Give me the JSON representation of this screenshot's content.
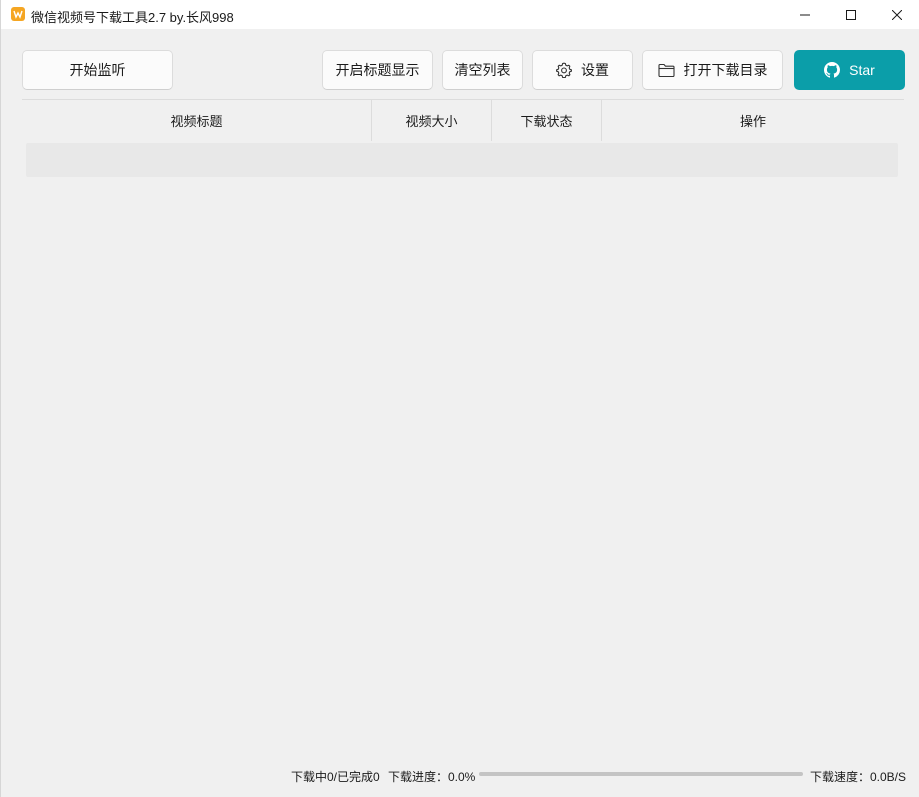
{
  "window": {
    "title": "微信视频号下载工具2.7 by.长风998",
    "icon": "app-logo-icon"
  },
  "toolbar": {
    "start_label": "开始监听",
    "title_display_label": "开启标题显示",
    "clear_label": "清空列表",
    "settings_label": "设置",
    "open_dir_label": "打开下载目录",
    "star_label": "Star"
  },
  "table": {
    "columns": [
      "视频标题",
      "视频大小",
      "下载状态",
      "操作"
    ],
    "rows": []
  },
  "status": {
    "downloading_text": "下载中0/已完成0",
    "progress_text": "下载进度：0.0%",
    "progress_value": 0.0,
    "speed_text": "下载速度：0.0B/S"
  },
  "colors": {
    "accent": "#0b9ea9",
    "icon": "#f5a623",
    "background": "#f0f0f0"
  }
}
